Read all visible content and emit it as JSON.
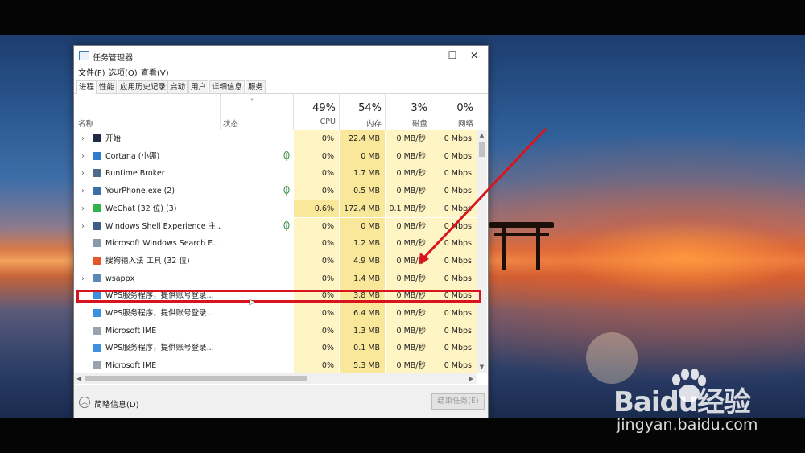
{
  "window": {
    "title": "任务管理器",
    "minimize": "—",
    "maximize": "☐",
    "close": "✕"
  },
  "menu": [
    "文件(F)",
    "选项(O)",
    "查看(V)"
  ],
  "tabs": [
    "进程",
    "性能",
    "应用历史记录",
    "启动",
    "用户",
    "详细信息",
    "服务"
  ],
  "active_tab": "进程",
  "columns": {
    "sort_indicator": "˅",
    "name": "名称",
    "status": "状态",
    "cpu": {
      "pct": "49%",
      "label": "CPU"
    },
    "memory": {
      "pct": "54%",
      "label": "内存"
    },
    "disk": {
      "pct": "3%",
      "label": "磁盘"
    },
    "network": {
      "pct": "0%",
      "label": "网络"
    }
  },
  "processes": [
    {
      "name": "开始",
      "expand": true,
      "icon": "start-app-icon",
      "eco": false,
      "cpu": "0%",
      "memory": "22.4 MB",
      "disk": "0 MB/秒",
      "network": "0 Mbps"
    },
    {
      "name": "Cortana (小娜)",
      "expand": true,
      "icon": "cortana-icon",
      "eco": true,
      "cpu": "0%",
      "memory": "0 MB",
      "disk": "0 MB/秒",
      "network": "0 Mbps"
    },
    {
      "name": "Runtime Broker",
      "expand": true,
      "icon": "runtime-broker-icon",
      "eco": false,
      "cpu": "0%",
      "memory": "1.7 MB",
      "disk": "0 MB/秒",
      "network": "0 Mbps"
    },
    {
      "name": "YourPhone.exe (2)",
      "expand": true,
      "icon": "yourphone-icon",
      "eco": true,
      "cpu": "0%",
      "memory": "0.5 MB",
      "disk": "0 MB/秒",
      "network": "0 Mbps"
    },
    {
      "name": "WeChat (32 位) (3)",
      "expand": true,
      "icon": "wechat-icon",
      "eco": false,
      "cpu": "0.6%",
      "memory": "172.4 MB",
      "disk": "0.1 MB/秒",
      "network": "0 Mbps"
    },
    {
      "name": "Windows Shell Experience 主...",
      "expand": true,
      "icon": "shell-experience-icon",
      "eco": true,
      "cpu": "0%",
      "memory": "0 MB",
      "disk": "0 MB/秒",
      "network": "0 Mbps"
    },
    {
      "name": "Microsoft Windows Search F...",
      "expand": false,
      "icon": "search-filter-icon",
      "eco": false,
      "cpu": "0%",
      "memory": "1.2 MB",
      "disk": "0 MB/秒",
      "network": "0 Mbps"
    },
    {
      "name": "搜狗输入法 工具 (32 位)",
      "expand": false,
      "icon": "sogou-icon",
      "eco": false,
      "cpu": "0%",
      "memory": "4.9 MB",
      "disk": "0 MB/秒",
      "network": "0 Mbps"
    },
    {
      "name": "wsappx",
      "expand": true,
      "icon": "wsappx-icon",
      "eco": false,
      "cpu": "0%",
      "memory": "1.4 MB",
      "disk": "0 MB/秒",
      "network": "0 Mbps"
    },
    {
      "name": "WPS服务程序，提供账号登录...",
      "expand": false,
      "icon": "wps-cloud-icon",
      "eco": false,
      "cpu": "0%",
      "memory": "3.8 MB",
      "disk": "0 MB/秒",
      "network": "0 Mbps"
    },
    {
      "name": "WPS服务程序，提供账号登录...",
      "expand": false,
      "icon": "wps-cloud-icon",
      "eco": false,
      "cpu": "0%",
      "memory": "6.4 MB",
      "disk": "0 MB/秒",
      "network": "0 Mbps"
    },
    {
      "name": "Microsoft IME",
      "expand": false,
      "icon": "ime-gear-icon",
      "eco": false,
      "cpu": "0%",
      "memory": "1.3 MB",
      "disk": "0 MB/秒",
      "network": "0 Mbps"
    },
    {
      "name": "WPS服务程序，提供账号登录...",
      "expand": false,
      "icon": "wps-cloud-icon",
      "eco": false,
      "cpu": "0%",
      "memory": "0.1 MB",
      "disk": "0 MB/秒",
      "network": "0 Mbps"
    },
    {
      "name": "Microsoft IME",
      "expand": false,
      "icon": "ime-gear-icon",
      "eco": false,
      "cpu": "0%",
      "memory": "5.3 MB",
      "disk": "0 MB/秒",
      "network": "0 Mbps"
    }
  ],
  "footer": {
    "fewer_details": "简略信息(D)",
    "end_task": "结束任务(E)"
  },
  "colors": {
    "metric_cell": "#fff4c4",
    "metric_cell_active": "#f9e79a",
    "highlight": "#d8141e",
    "arrow": "#d8141e"
  },
  "watermark": {
    "logo": "Baidu经验",
    "url": "jingyan.baidu.com"
  }
}
